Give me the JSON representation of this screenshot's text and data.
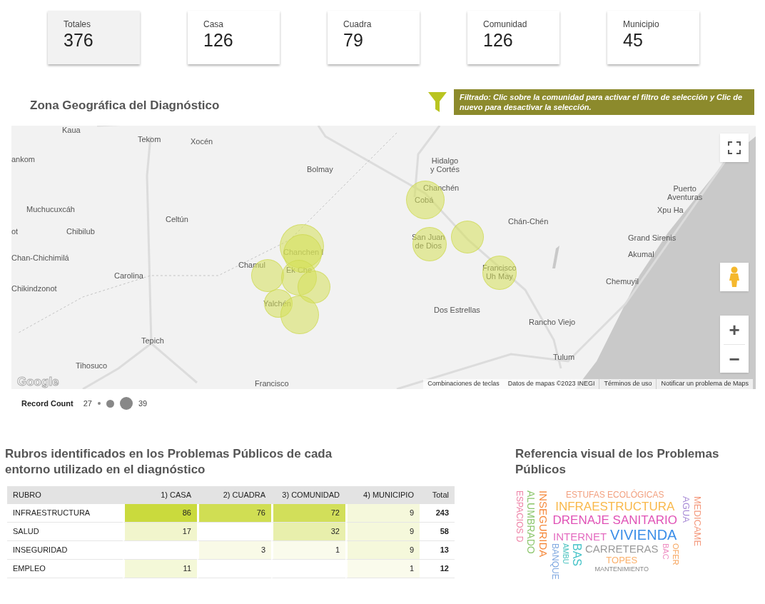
{
  "kpis": [
    {
      "label": "Totales",
      "value": "376",
      "selected": true
    },
    {
      "label": "Casa",
      "value": "126",
      "selected": false
    },
    {
      "label": "Cuadra",
      "value": "79",
      "selected": false
    },
    {
      "label": "Comunidad",
      "value": "126",
      "selected": false
    },
    {
      "label": "Municipio",
      "value": "45",
      "selected": false
    }
  ],
  "map_section": {
    "title": "Zona Geográfica del Diagnóstico",
    "filter_note": "Filtrado: Clic sobre la comunidad para activar el filtro de selección y Clic de nuevo para desactivar la selección."
  },
  "map": {
    "place_labels": [
      "Kaua",
      "Tekom",
      "Xocén",
      "ankom",
      "Bolmay",
      "Hidalgo\ny Cortés",
      "Chanchén",
      "Cobá",
      "Puerto\nAventuras",
      "Xpu Ha",
      "Muchucuxcáh",
      "Celtún",
      "Chán-Chén",
      "ot",
      "Chibilub",
      "Chanchen I",
      "San Juan\nde Dios",
      "Grand Sirenis",
      "Akumal",
      "Chan-Chichimilá",
      "Chamul",
      "Ek Che",
      "Carolina",
      "Francisco\nUh May",
      "Chemuyil",
      "Chikindzonot",
      "Yalchén",
      "Dos Estrellas",
      "Rancho Viejo",
      "Tepich",
      "Tulum",
      "Tihosuco",
      "Francisco"
    ],
    "logo": "Google",
    "attribution": [
      "Combinaciones de teclas",
      "Datos de mapas ©2023 INEGI",
      "Términos de uso",
      "Notificar un problema de Maps"
    ],
    "zoom_in": "+",
    "zoom_out": "−"
  },
  "legend": {
    "title": "Record Count",
    "min": "27",
    "max": "39"
  },
  "table_section": {
    "title": "Rubros identificados en los Problemas Públicos de cada entorno utilizado en el diagnóstico",
    "columns": [
      "RUBRO",
      "1) CASA",
      "2) CUADRA",
      "3) COMUNIDAD",
      "4) MUNICIPIO",
      "Total"
    ],
    "rows": [
      [
        "INFRAESTRUCTURA",
        "86",
        "76",
        "72",
        "9",
        "243"
      ],
      [
        "SALUD",
        "17",
        "",
        "32",
        "9",
        "58"
      ],
      [
        "INSEGURIDAD",
        "",
        "3",
        "1",
        "9",
        "13"
      ],
      [
        "EMPLEO",
        "11",
        "",
        "",
        "1",
        "12"
      ]
    ]
  },
  "cloud_section": {
    "title": "Referencia visual de los Problemas Públicos",
    "words": [
      {
        "text": "ESTUFAS ECOLÓGICAS",
        "kind": "horizontal",
        "color": "#f2a07f"
      },
      {
        "text": "INFRAESTRUCTURA",
        "kind": "horizontal",
        "color": "#f9b84a"
      },
      {
        "text": "DRENAJE SANITARIO",
        "kind": "horizontal",
        "color": "#e052b6"
      },
      {
        "text": "INTERNET",
        "kind": "horizontal",
        "color": "#e46cc0"
      },
      {
        "text": "VIVIENDA",
        "kind": "horizontal",
        "color": "#3d8fe8"
      },
      {
        "text": "CARRETERAS",
        "kind": "horizontal",
        "color": "#9a9a9a"
      },
      {
        "text": "TOPES",
        "kind": "horizontal",
        "color": "#fbb06a"
      },
      {
        "text": "MANTENIMIENTO",
        "kind": "horizontal",
        "color": "#8a8a8a"
      },
      {
        "text": "ALUMBRADO",
        "kind": "vertical",
        "color": "#8cc66c"
      },
      {
        "text": "ESPACIOS D",
        "kind": "vertical",
        "color": "#ee82a6"
      },
      {
        "text": "INSEGURIDA",
        "kind": "vertical",
        "color": "#f5893c"
      },
      {
        "text": "BANQUE",
        "kind": "vertical",
        "color": "#7fa8e0"
      },
      {
        "text": "AMBU",
        "kind": "vertical",
        "color": "#4cc3c0"
      },
      {
        "text": "BAS",
        "kind": "vertical",
        "color": "#45c3c8"
      },
      {
        "text": "BAC",
        "kind": "vertical",
        "color": "#ee8ac0"
      },
      {
        "text": "OFER",
        "kind": "vertical",
        "color": "#f7a35a"
      },
      {
        "text": "AGUA",
        "kind": "vertical",
        "color": "#a98cd6"
      },
      {
        "text": "MEDICAME",
        "kind": "vertical",
        "color": "#f4977a"
      }
    ]
  }
}
